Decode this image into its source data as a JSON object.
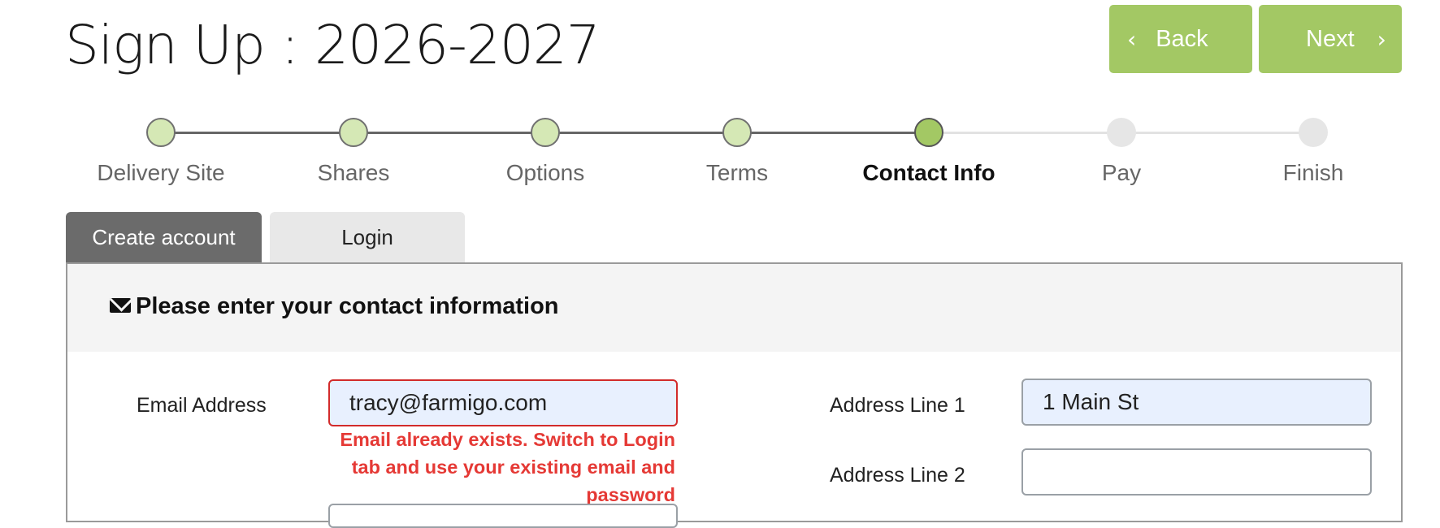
{
  "page": {
    "title": "Sign Up : 2026-2027"
  },
  "nav": {
    "back_label": "Back",
    "next_label": "Next",
    "back_icon": "‹",
    "next_icon": "›",
    "accent_color": "#a3c864"
  },
  "steps": [
    {
      "label": "Delivery Site",
      "state": "done"
    },
    {
      "label": "Shares",
      "state": "done"
    },
    {
      "label": "Options",
      "state": "done"
    },
    {
      "label": "Terms",
      "state": "done"
    },
    {
      "label": "Contact Info",
      "state": "current"
    },
    {
      "label": "Pay",
      "state": "todo"
    },
    {
      "label": "Finish",
      "state": "todo"
    }
  ],
  "tabs": {
    "create_account": "Create account",
    "login": "Login",
    "active": "Create account"
  },
  "panel": {
    "title": "Please enter your contact information",
    "icon": "envelope-icon"
  },
  "form": {
    "email": {
      "label": "Email Address",
      "value": "tracy@farmigo.com",
      "error": "Email already exists. Switch to Login tab and use your existing email and password"
    },
    "address1": {
      "label": "Address Line 1",
      "value": "1 Main St"
    },
    "address2": {
      "label": "Address Line 2",
      "value": ""
    }
  },
  "colors": {
    "error": "#e53935",
    "tab_active_bg": "#6b6b6b",
    "tab_inactive_bg": "#e8e8e8"
  }
}
